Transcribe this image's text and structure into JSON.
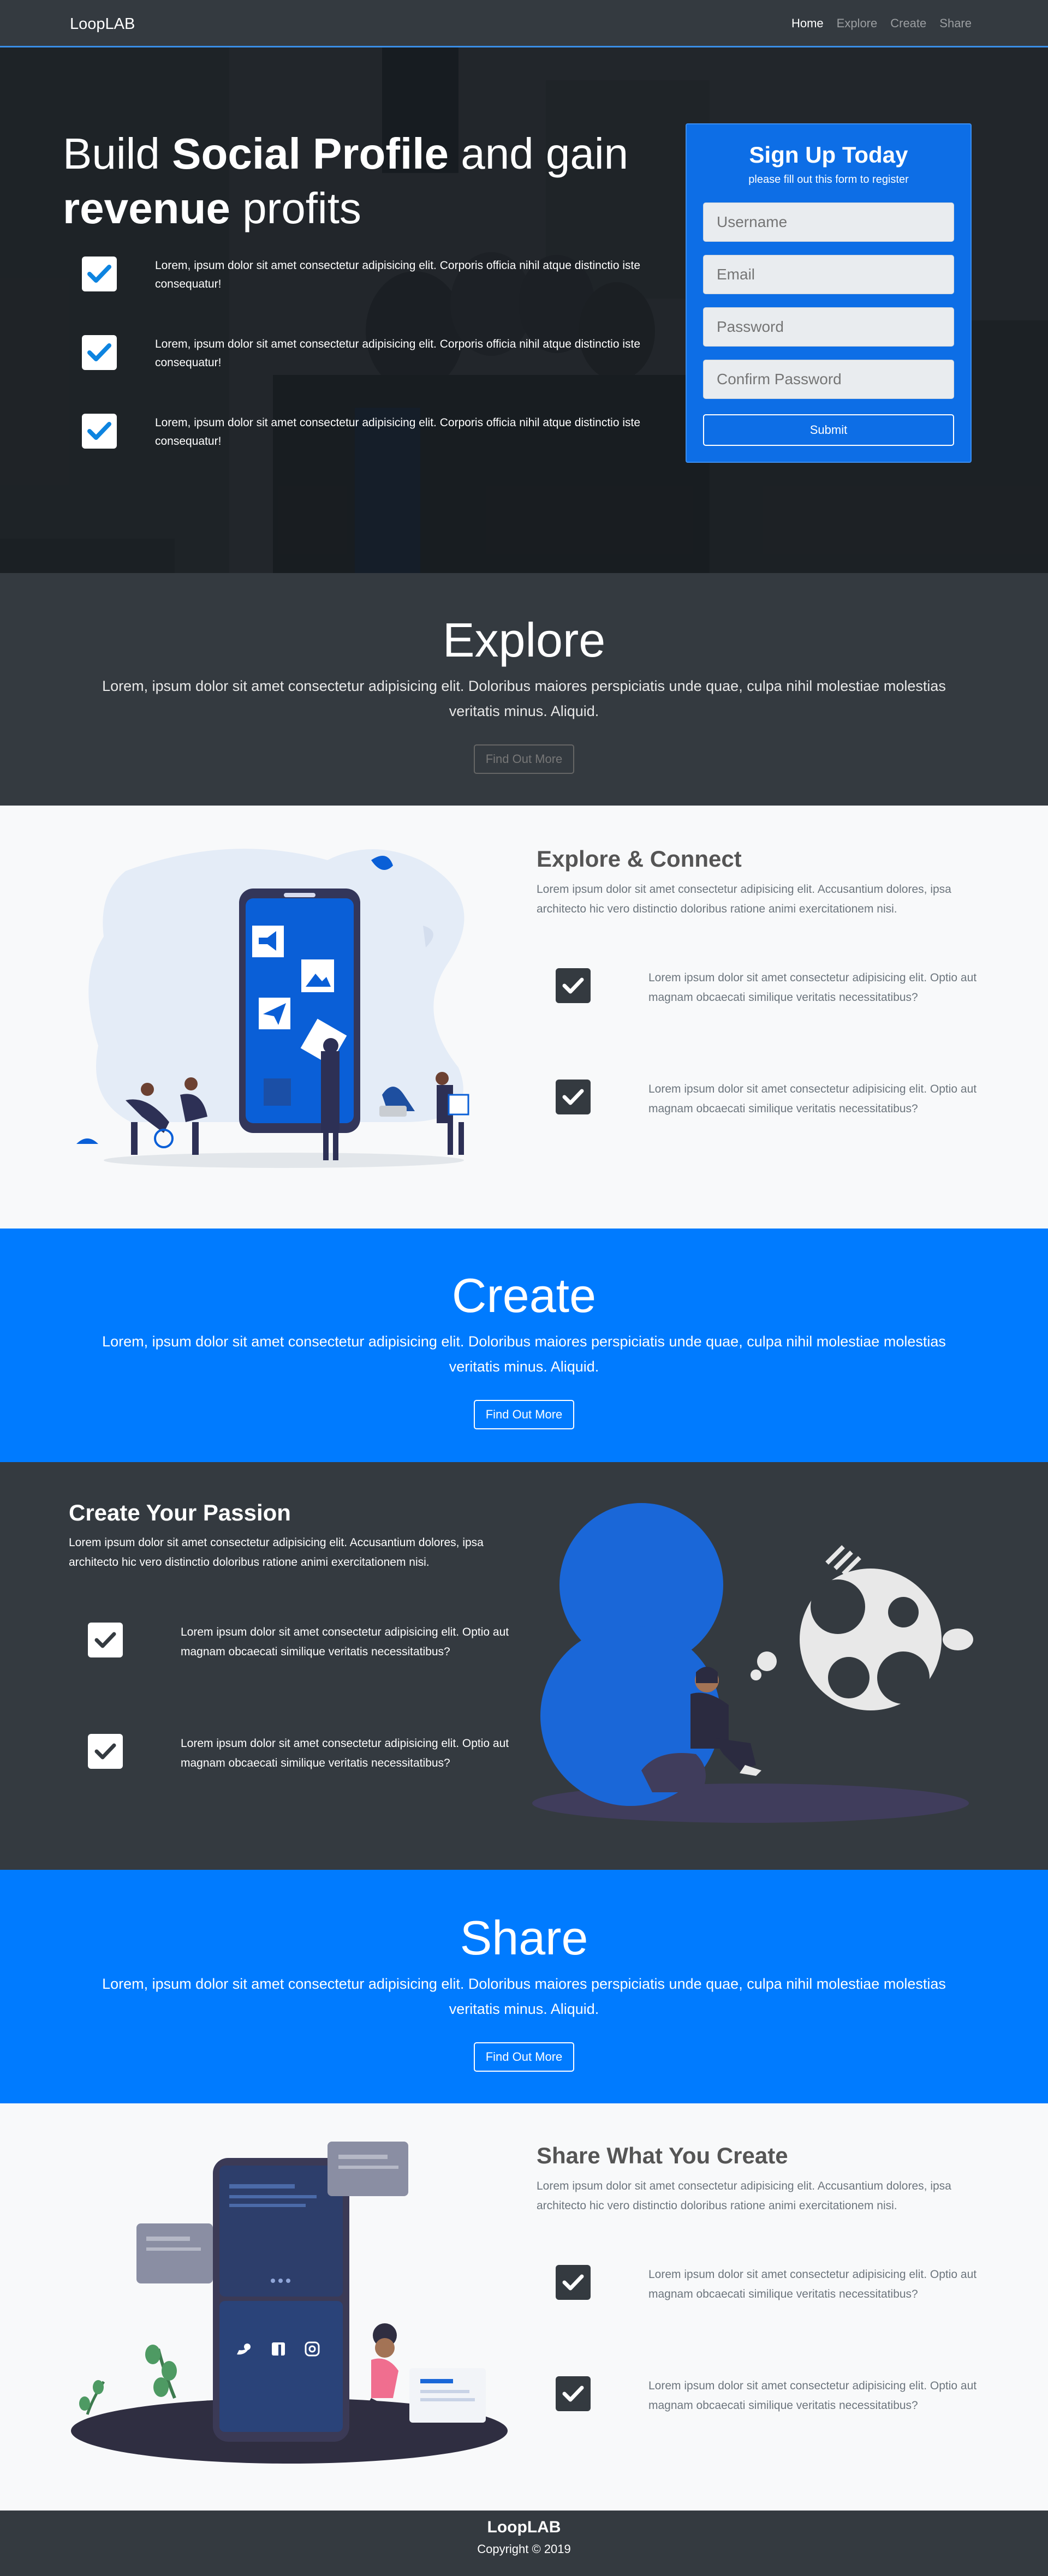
{
  "nav": {
    "brand": "LoopLAB",
    "links": [
      "Home",
      "Explore",
      "Create",
      "Share"
    ]
  },
  "hero": {
    "title_a": "Build ",
    "title_b": "Social Profile",
    "title_c": " and gain",
    "title_d": "revenue",
    "title_e": " profits",
    "items": [
      "Lorem, ipsum dolor sit amet consectetur adipisicing elit. Corporis officia nihil atque distinctio iste consequatur!",
      "Lorem, ipsum dolor sit amet consectetur adipisicing elit. Corporis officia nihil atque distinctio iste consequatur!",
      "Lorem, ipsum dolor sit amet consectetur adipisicing elit. Corporis officia nihil atque distinctio iste consequatur!"
    ]
  },
  "signup": {
    "title": "Sign Up Today",
    "subtitle": "please fill out this form to register",
    "username_placeholder": "Username",
    "email_placeholder": "Email",
    "password_placeholder": "Password",
    "confirm_placeholder": "Confirm Password",
    "submit_label": "Submit"
  },
  "explore_band": {
    "title": "Explore",
    "text": "Lorem, ipsum dolor sit amet consectetur adipisicing elit. Doloribus maiores perspiciatis unde quae, culpa nihil molestiae molestias veritatis minus. Aliquid.",
    "button": "Find Out More"
  },
  "explore_feature": {
    "title": "Explore & Connect",
    "lead": "Lorem ipsum dolor sit amet consectetur adipisicing elit. Accusantium dolores, ipsa architecto hic vero distinctio doloribus ratione animi exercitationem nisi.",
    "items": [
      "Lorem ipsum dolor sit amet consectetur adipisicing elit. Optio aut magnam obcaecati similique veritatis necessitatibus?",
      "Lorem ipsum dolor sit amet consectetur adipisicing elit. Optio aut magnam obcaecati similique veritatis necessitatibus?"
    ]
  },
  "create_band": {
    "title": "Create",
    "text": "Lorem, ipsum dolor sit amet consectetur adipisicing elit. Doloribus maiores perspiciatis unde quae, culpa nihil molestiae molestias veritatis minus. Aliquid.",
    "button": "Find Out More"
  },
  "create_feature": {
    "title": "Create Your Passion",
    "lead": "Lorem ipsum dolor sit amet consectetur adipisicing elit. Accusantium dolores, ipsa architecto hic vero distinctio doloribus ratione animi exercitationem nisi.",
    "items": [
      "Lorem ipsum dolor sit amet consectetur adipisicing elit. Optio aut magnam obcaecati similique veritatis necessitatibus?",
      "Lorem ipsum dolor sit amet consectetur adipisicing elit. Optio aut magnam obcaecati similique veritatis necessitatibus?"
    ]
  },
  "share_band": {
    "title": "Share",
    "text": "Lorem, ipsum dolor sit amet consectetur adipisicing elit. Doloribus maiores perspiciatis unde quae, culpa nihil molestiae molestias veritatis minus. Aliquid.",
    "button": "Find Out More"
  },
  "share_feature": {
    "title": "Share What You Create",
    "lead": "Lorem ipsum dolor sit amet consectetur adipisicing elit. Accusantium dolores, ipsa architecto hic vero distinctio doloribus ratione animi exercitationem nisi.",
    "items": [
      "Lorem ipsum dolor sit amet consectetur adipisicing elit. Optio aut magnam obcaecati similique veritatis necessitatibus?",
      "Lorem ipsum dolor sit amet consectetur adipisicing elit. Optio aut magnam obcaecati similique veritatis necessitatibus?"
    ]
  },
  "footer": {
    "brand": "LoopLAB",
    "copyright": "Copyright © 2019"
  },
  "colors": {
    "primary": "#007bff",
    "dark": "#343a40",
    "light": "#f8f9fa",
    "nav_underline": "#3a8ee6"
  },
  "icons": [
    "check-icon",
    "megaphone-icon",
    "image-icon",
    "paper-plane-icon",
    "twitter-icon",
    "facebook-icon",
    "instagram-icon"
  ]
}
